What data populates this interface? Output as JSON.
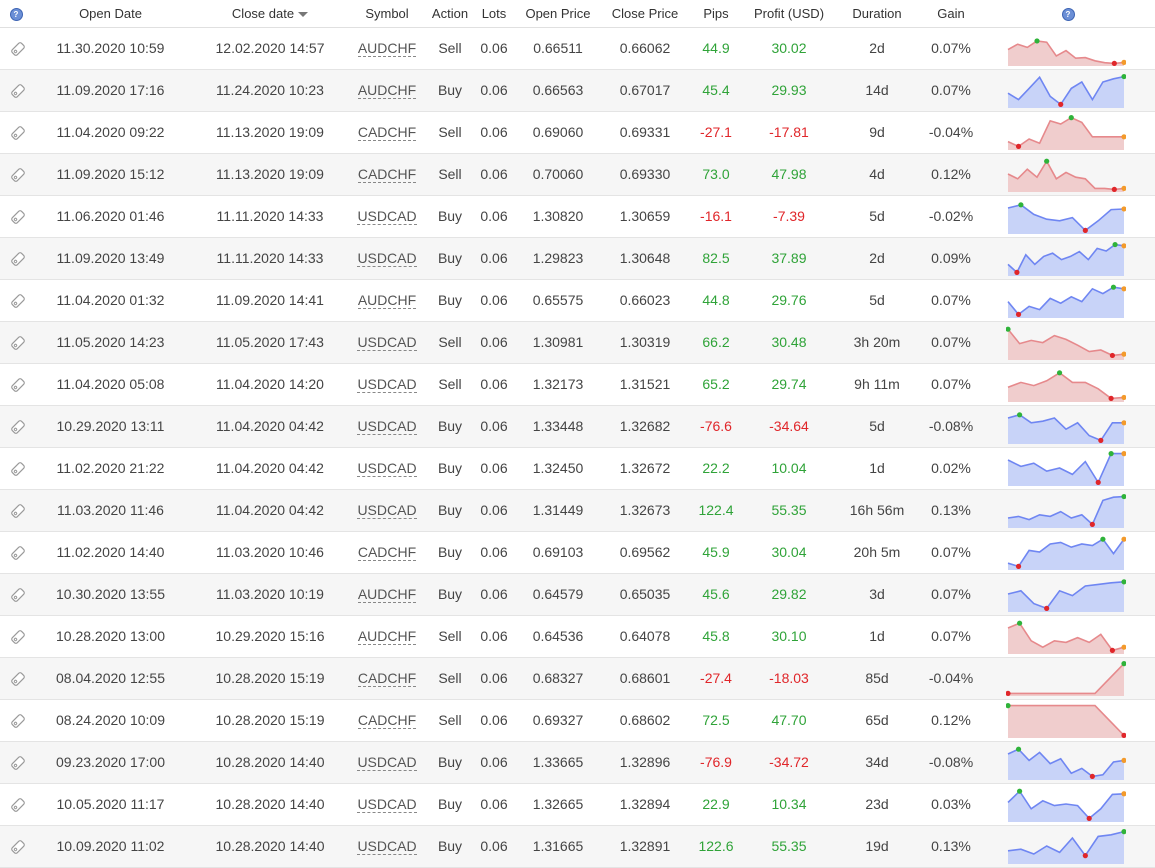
{
  "header": {
    "open_date": "Open Date",
    "close_date": "Close date",
    "symbol": "Symbol",
    "action": "Action",
    "lots": "Lots",
    "open_price": "Open Price",
    "close_price": "Close Price",
    "pips": "Pips",
    "profit": "Profit (USD)",
    "duration": "Duration",
    "gain": "Gain",
    "info_icon": "?"
  },
  "colors": {
    "positive": "#2fa338",
    "negative": "#e0262a",
    "buy_fill": "#c8d3f8",
    "buy_line": "#6f86f2",
    "sell_fill": "#f0cdcd",
    "sell_line": "#e6898c"
  },
  "icons": {
    "row_tag": "tag-icon",
    "help": "help-icon",
    "sort": "sort-desc-icon"
  },
  "trades": [
    {
      "open": "11.30.2020 10:59",
      "close": "12.02.2020 14:57",
      "symbol": "AUDCHF",
      "action": "Sell",
      "lots": "0.06",
      "open_price": "0.66511",
      "close_price": "0.66062",
      "pips": "44.9",
      "profit": "30.02",
      "duration": "2d",
      "gain": "0.07%",
      "trend": [
        0.45,
        0.62,
        0.52,
        0.72,
        0.68,
        0.25,
        0.42,
        0.18,
        0.2,
        0.1,
        0.04,
        0.02,
        0.05
      ]
    },
    {
      "open": "11.09.2020 17:16",
      "close": "11.24.2020 10:23",
      "symbol": "AUDCHF",
      "action": "Buy",
      "lots": "0.06",
      "open_price": "0.66563",
      "close_price": "0.67017",
      "pips": "45.4",
      "profit": "29.93",
      "duration": "14d",
      "gain": "0.07%",
      "trend": [
        0.4,
        0.2,
        0.55,
        0.9,
        0.3,
        0.05,
        0.55,
        0.75,
        0.2,
        0.75,
        0.85,
        0.92
      ]
    },
    {
      "open": "11.04.2020 09:22",
      "close": "11.13.2020 19:09",
      "symbol": "CADCHF",
      "action": "Sell",
      "lots": "0.06",
      "open_price": "0.69060",
      "close_price": "0.69331",
      "pips": "-27.1",
      "profit": "-17.81",
      "duration": "9d",
      "gain": "-0.04%",
      "trend": [
        0.2,
        0.05,
        0.28,
        0.15,
        0.85,
        0.75,
        0.95,
        0.8,
        0.35,
        0.35,
        0.35,
        0.35
      ]
    },
    {
      "open": "11.09.2020 15:12",
      "close": "11.13.2020 19:09",
      "symbol": "CADCHF",
      "action": "Sell",
      "lots": "0.06",
      "open_price": "0.70060",
      "close_price": "0.69330",
      "pips": "73.0",
      "profit": "47.98",
      "duration": "4d",
      "gain": "0.12%",
      "trend": [
        0.5,
        0.35,
        0.65,
        0.4,
        0.9,
        0.35,
        0.55,
        0.4,
        0.35,
        0.05,
        0.05,
        0.02,
        0.05
      ]
    },
    {
      "open": "11.06.2020 01:46",
      "close": "11.11.2020 14:33",
      "symbol": "USDCAD",
      "action": "Buy",
      "lots": "0.06",
      "open_price": "1.30820",
      "close_price": "1.30659",
      "pips": "-16.1",
      "profit": "-7.39",
      "duration": "5d",
      "gain": "-0.02%",
      "trend": [
        0.75,
        0.85,
        0.55,
        0.4,
        0.35,
        0.45,
        0.05,
        0.35,
        0.7,
        0.72
      ]
    },
    {
      "open": "11.09.2020 13:49",
      "close": "11.11.2020 14:33",
      "symbol": "USDCAD",
      "action": "Buy",
      "lots": "0.06",
      "open_price": "1.29823",
      "close_price": "1.30648",
      "pips": "82.5",
      "profit": "37.89",
      "duration": "2d",
      "gain": "0.09%",
      "trend": [
        0.3,
        0.05,
        0.6,
        0.3,
        0.55,
        0.65,
        0.45,
        0.55,
        0.7,
        0.45,
        0.8,
        0.72,
        0.92,
        0.88
      ]
    },
    {
      "open": "11.04.2020 01:32",
      "close": "11.09.2020 14:41",
      "symbol": "AUDCHF",
      "action": "Buy",
      "lots": "0.06",
      "open_price": "0.65575",
      "close_price": "0.66023",
      "pips": "44.8",
      "profit": "29.76",
      "duration": "5d",
      "gain": "0.07%",
      "trend": [
        0.45,
        0.05,
        0.3,
        0.2,
        0.55,
        0.4,
        0.6,
        0.45,
        0.85,
        0.7,
        0.9,
        0.85
      ]
    },
    {
      "open": "11.05.2020 14:23",
      "close": "11.05.2020 17:43",
      "symbol": "USDCAD",
      "action": "Sell",
      "lots": "0.06",
      "open_price": "1.30981",
      "close_price": "1.30319",
      "pips": "66.2",
      "profit": "30.48",
      "duration": "3h 20m",
      "gain": "0.07%",
      "trend": [
        0.9,
        0.45,
        0.55,
        0.48,
        0.7,
        0.58,
        0.4,
        0.2,
        0.25,
        0.08,
        0.12
      ]
    },
    {
      "open": "11.04.2020 05:08",
      "close": "11.04.2020 14:20",
      "symbol": "USDCAD",
      "action": "Sell",
      "lots": "0.06",
      "open_price": "1.32173",
      "close_price": "1.31521",
      "pips": "65.2",
      "profit": "29.74",
      "duration": "9h 11m",
      "gain": "0.07%",
      "trend": [
        0.4,
        0.55,
        0.45,
        0.6,
        0.85,
        0.55,
        0.55,
        0.35,
        0.05,
        0.08
      ]
    },
    {
      "open": "10.29.2020 13:11",
      "close": "11.04.2020 04:42",
      "symbol": "USDCAD",
      "action": "Buy",
      "lots": "0.06",
      "open_price": "1.33448",
      "close_price": "1.32682",
      "pips": "-76.6",
      "profit": "-34.64",
      "duration": "5d",
      "gain": "-0.08%",
      "trend": [
        0.75,
        0.85,
        0.6,
        0.65,
        0.75,
        0.4,
        0.6,
        0.2,
        0.05,
        0.6,
        0.6
      ]
    },
    {
      "open": "11.02.2020 21:22",
      "close": "11.04.2020 04:42",
      "symbol": "USDCAD",
      "action": "Buy",
      "lots": "0.06",
      "open_price": "1.32450",
      "close_price": "1.32672",
      "pips": "22.2",
      "profit": "10.04",
      "duration": "1d",
      "gain": "0.02%",
      "trend": [
        0.75,
        0.55,
        0.65,
        0.4,
        0.5,
        0.3,
        0.7,
        0.05,
        0.95,
        0.95
      ]
    },
    {
      "open": "11.03.2020 11:46",
      "close": "11.04.2020 04:42",
      "symbol": "USDCAD",
      "action": "Buy",
      "lots": "0.06",
      "open_price": "1.31449",
      "close_price": "1.32673",
      "pips": "122.4",
      "profit": "55.35",
      "duration": "16h 56m",
      "gain": "0.13%",
      "trend": [
        0.25,
        0.3,
        0.2,
        0.35,
        0.3,
        0.45,
        0.25,
        0.35,
        0.05,
        0.8,
        0.9,
        0.92
      ]
    },
    {
      "open": "11.02.2020 14:40",
      "close": "11.03.2020 10:46",
      "symbol": "CADCHF",
      "action": "Buy",
      "lots": "0.06",
      "open_price": "0.69103",
      "close_price": "0.69562",
      "pips": "45.9",
      "profit": "30.04",
      "duration": "20h 5m",
      "gain": "0.07%",
      "trend": [
        0.15,
        0.05,
        0.55,
        0.5,
        0.75,
        0.8,
        0.65,
        0.75,
        0.7,
        0.9,
        0.45,
        0.9
      ]
    },
    {
      "open": "10.30.2020 13:55",
      "close": "11.03.2020 10:19",
      "symbol": "AUDCHF",
      "action": "Buy",
      "lots": "0.06",
      "open_price": "0.64579",
      "close_price": "0.65035",
      "pips": "45.6",
      "profit": "29.82",
      "duration": "3d",
      "gain": "0.07%",
      "trend": [
        0.5,
        0.6,
        0.2,
        0.05,
        0.6,
        0.45,
        0.75,
        0.8,
        0.85,
        0.88
      ]
    },
    {
      "open": "10.28.2020 13:00",
      "close": "10.29.2020 15:16",
      "symbol": "AUDCHF",
      "action": "Sell",
      "lots": "0.06",
      "open_price": "0.64536",
      "close_price": "0.64078",
      "pips": "45.8",
      "profit": "30.10",
      "duration": "1d",
      "gain": "0.07%",
      "trend": [
        0.75,
        0.9,
        0.35,
        0.15,
        0.35,
        0.3,
        0.45,
        0.3,
        0.55,
        0.05,
        0.15
      ]
    },
    {
      "open": "08.04.2020 12:55",
      "close": "10.28.2020 15:19",
      "symbol": "CADCHF",
      "action": "Sell",
      "lots": "0.06",
      "open_price": "0.68327",
      "close_price": "0.68601",
      "pips": "-27.4",
      "profit": "-18.03",
      "duration": "85d",
      "gain": "-0.04%",
      "trend": [
        0.02,
        0.02,
        0.02,
        0.02,
        0.95
      ]
    },
    {
      "open": "08.24.2020 10:09",
      "close": "10.28.2020 15:19",
      "symbol": "CADCHF",
      "action": "Sell",
      "lots": "0.06",
      "open_price": "0.69327",
      "close_price": "0.68602",
      "pips": "72.5",
      "profit": "47.70",
      "duration": "65d",
      "gain": "0.12%",
      "trend": [
        0.95,
        0.95,
        0.95,
        0.95,
        0.02
      ]
    },
    {
      "open": "09.23.2020 17:00",
      "close": "10.28.2020 14:40",
      "symbol": "USDCAD",
      "action": "Buy",
      "lots": "0.06",
      "open_price": "1.33665",
      "close_price": "1.32896",
      "pips": "-76.9",
      "profit": "-34.72",
      "duration": "34d",
      "gain": "-0.08%",
      "trend": [
        0.75,
        0.9,
        0.55,
        0.8,
        0.45,
        0.6,
        0.15,
        0.3,
        0.05,
        0.1,
        0.5,
        0.55
      ]
    },
    {
      "open": "10.05.2020 11:17",
      "close": "10.28.2020 14:40",
      "symbol": "USDCAD",
      "action": "Buy",
      "lots": "0.06",
      "open_price": "1.32665",
      "close_price": "1.32894",
      "pips": "22.9",
      "profit": "10.34",
      "duration": "23d",
      "gain": "0.03%",
      "trend": [
        0.55,
        0.9,
        0.35,
        0.6,
        0.45,
        0.5,
        0.45,
        0.05,
        0.35,
        0.8,
        0.82
      ]
    },
    {
      "open": "10.09.2020 11:02",
      "close": "10.28.2020 14:40",
      "symbol": "USDCAD",
      "action": "Buy",
      "lots": "0.06",
      "open_price": "1.31665",
      "close_price": "1.32891",
      "pips": "122.6",
      "profit": "55.35",
      "duration": "19d",
      "gain": "0.13%",
      "trend": [
        0.35,
        0.4,
        0.25,
        0.5,
        0.3,
        0.75,
        0.2,
        0.8,
        0.85,
        0.95
      ]
    }
  ]
}
